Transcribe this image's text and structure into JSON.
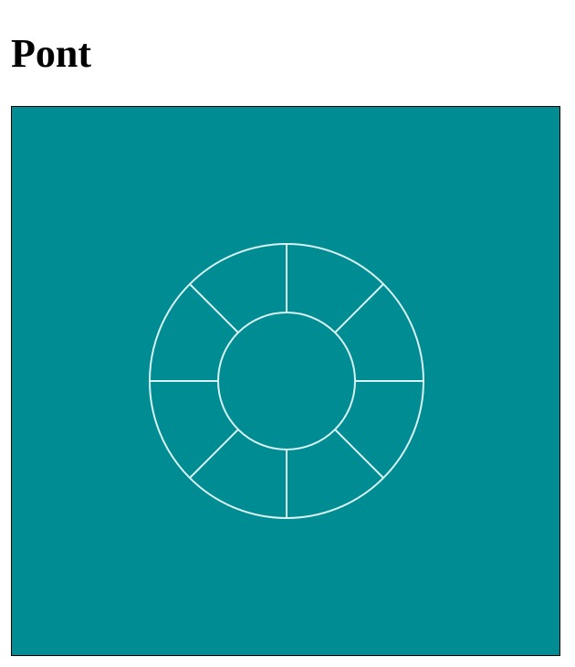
{
  "page": {
    "title": "Pont"
  },
  "figure": {
    "background_color": "#008c93",
    "stroke_color": "#d8f1f2",
    "shape": "segmented-ring",
    "segments": 8
  }
}
